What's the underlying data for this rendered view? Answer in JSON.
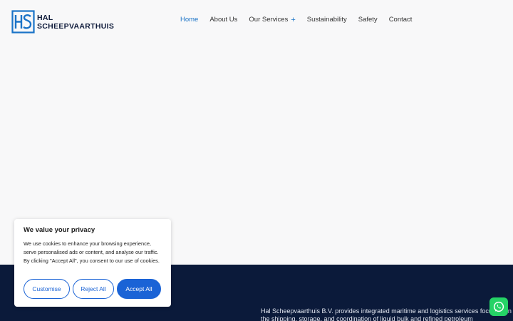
{
  "brand": {
    "line1": "HAL",
    "line2": "SCHEEPVAARTHUIS"
  },
  "nav": {
    "items": [
      {
        "label": "Home",
        "active": true
      },
      {
        "label": "About Us"
      },
      {
        "label": "Our Services",
        "has_submenu": true
      },
      {
        "label": "Sustainability"
      },
      {
        "label": "Safety"
      },
      {
        "label": "Contact"
      }
    ]
  },
  "cookie_banner": {
    "title": "We value your privacy",
    "body": "We use cookies to enhance your browsing experience, serve personalised ads or content, and analyse our traffic. By clicking \"Accept All\", you consent to our use of cookies.",
    "customise_label": "Customise",
    "reject_label": "Reject All",
    "accept_label": "Accept All"
  },
  "footer": {
    "description": "Hal Scheepvaarthuis B.V. provides integrated maritime and logistics services focused on the shipping, storage, and coordination of liquid bulk and refined petroleum"
  },
  "colors": {
    "accent": "#1a73c7",
    "button_blue": "#1a63d6",
    "footer_bg": "#0b1a3a",
    "whatsapp": "#25d366"
  },
  "icons": {
    "logo": "hs-monogram-icon",
    "whatsapp": "whatsapp-icon",
    "submenu": "plus-icon"
  }
}
